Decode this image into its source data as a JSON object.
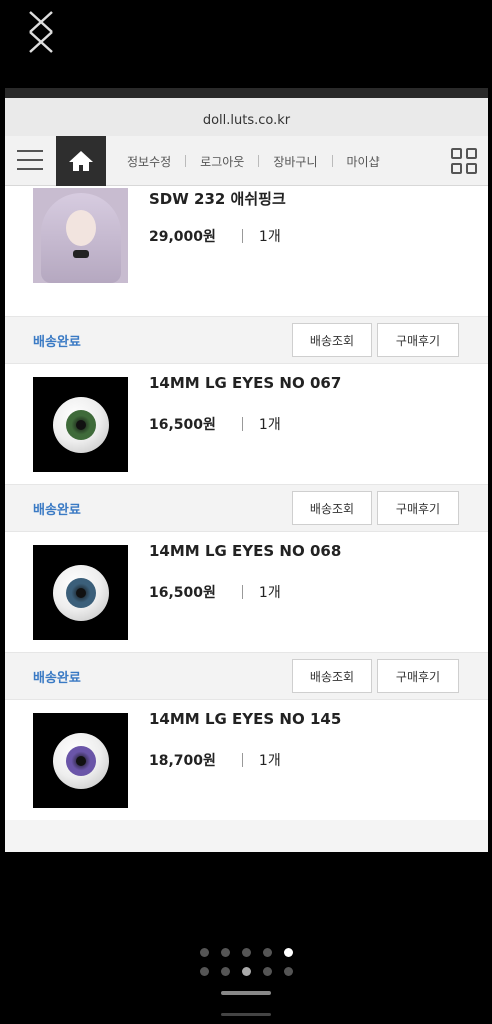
{
  "browser": {
    "url": "doll.luts.co.kr"
  },
  "nav": {
    "links": [
      "정보수정",
      "로그아웃",
      "장바구니",
      "마이샵"
    ]
  },
  "orders": [
    {
      "name": "SDW 232 애쉬핑크",
      "price": "29,000원",
      "qty": "1개",
      "status": "배송완료",
      "track_label": "배송조회",
      "review_label": "구매후기",
      "thumb": "doll-image"
    },
    {
      "name": "14MM LG EYES NO 067",
      "price": "16,500원",
      "qty": "1개",
      "status": "배송완료",
      "track_label": "배송조회",
      "review_label": "구매후기",
      "thumb": "eye-image",
      "iris_color": "#3f6b3a"
    },
    {
      "name": "14MM LG EYES NO 068",
      "price": "16,500원",
      "qty": "1개",
      "status": "배송완료",
      "track_label": "배송조회",
      "review_label": "구매후기",
      "thumb": "eye-image",
      "iris_color": "#3b5f7a"
    },
    {
      "name": "14MM LG EYES NO 145",
      "price": "18,700원",
      "qty": "1개",
      "thumb": "eye-image",
      "iris_color": "#6a55a8"
    }
  ],
  "colors": {
    "status_blue": "#3a7ac4",
    "home_button_bg": "#2e2e2e"
  },
  "icons": [
    "close-icon",
    "hamburger-icon",
    "home-icon",
    "grid-menu-icon"
  ]
}
